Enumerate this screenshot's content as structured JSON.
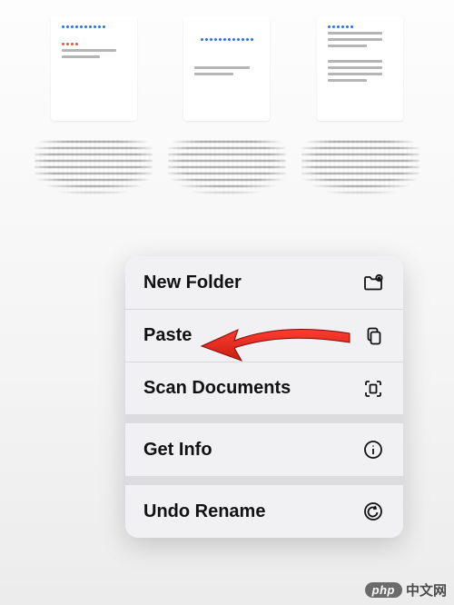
{
  "thumbnails": [
    {
      "id": "doc-1"
    },
    {
      "id": "doc-2"
    },
    {
      "id": "doc-3"
    }
  ],
  "menu": {
    "groups": [
      [
        {
          "key": "new_folder",
          "label": "New Folder",
          "icon": "folder-plus-icon"
        },
        {
          "key": "paste",
          "label": "Paste",
          "icon": "paste-icon",
          "highlighted": true
        },
        {
          "key": "scan_documents",
          "label": "Scan Documents",
          "icon": "scan-icon"
        }
      ],
      [
        {
          "key": "get_info",
          "label": "Get Info",
          "icon": "info-icon"
        }
      ],
      [
        {
          "key": "undo_rename",
          "label": "Undo Rename",
          "icon": "undo-icon"
        }
      ]
    ]
  },
  "watermark": {
    "brand": "php",
    "text": "中文网"
  }
}
